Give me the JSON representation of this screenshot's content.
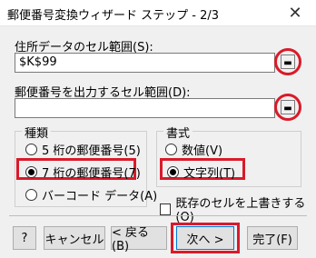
{
  "window": {
    "title": "郵便番号変換ウィザード ステップ - 2/3",
    "close_glyph": "✕"
  },
  "address_range": {
    "label": "住所データのセル範囲(S):",
    "value": "$K$99"
  },
  "output_range": {
    "label": "郵便番号を出力するセル範囲(D):",
    "value": ""
  },
  "type_group": {
    "title": "種類",
    "options": [
      {
        "label": "5 桁の郵便番号(5)",
        "selected": false
      },
      {
        "label": "7 桁の郵便番号(7)",
        "selected": true
      },
      {
        "label": "バーコード データ(A)",
        "selected": false
      }
    ]
  },
  "format_group": {
    "title": "書式",
    "options": [
      {
        "label": "数値(V)",
        "selected": false
      },
      {
        "label": "文字列(T)",
        "selected": true
      }
    ]
  },
  "overwrite_checkbox": {
    "label": "既存のセルを上書きする(O)",
    "checked": false
  },
  "buttons": {
    "help_glyph": "?",
    "cancel": "キャンセル",
    "back": "< 戻る(B)",
    "next": "次へ >",
    "finish": "完了(F)"
  },
  "colors": {
    "highlight_red": "#d91a2a",
    "primary_border": "#0078d7"
  }
}
